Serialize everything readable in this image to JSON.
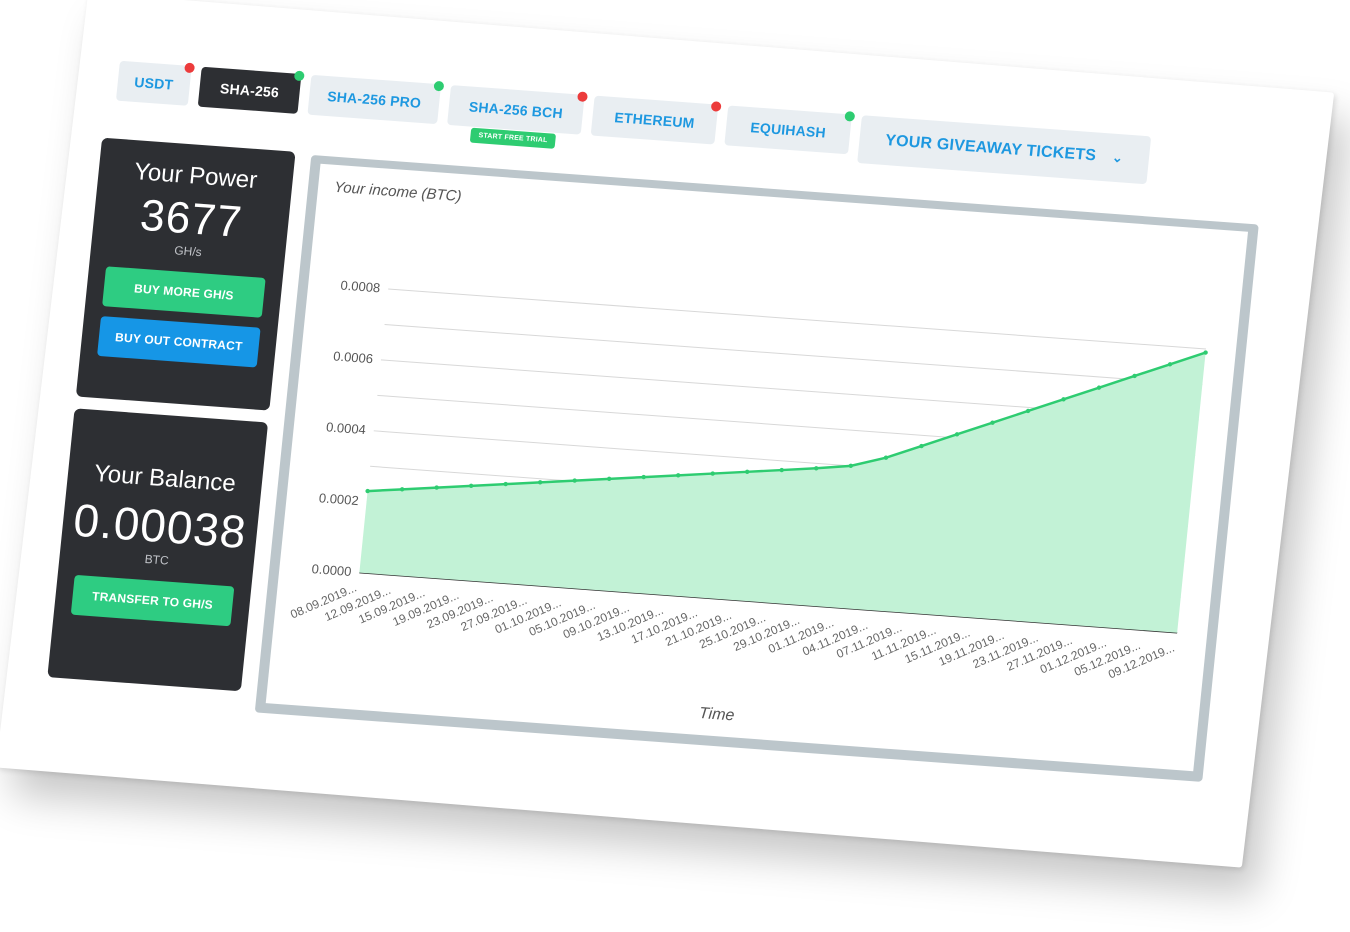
{
  "tabs": [
    {
      "label": "USDT",
      "dot": "red",
      "active": false
    },
    {
      "label": "SHA-256",
      "dot": "green",
      "active": true
    },
    {
      "label": "SHA-256 PRO",
      "dot": "green",
      "active": false
    },
    {
      "label": "SHA-256 BCH",
      "dot": "red",
      "active": false,
      "badge": "START FREE TRIAL"
    },
    {
      "label": "ETHEREUM",
      "dot": "red",
      "active": false
    },
    {
      "label": "EQUIHASH",
      "dot": "green",
      "active": false
    },
    {
      "label": "YOUR GIVEAWAY TICKETS",
      "active": false,
      "icon": "chevron-down-icon"
    }
  ],
  "power": {
    "title": "Your Power",
    "value": "3677",
    "unit": "GH/s",
    "buy_more_label": "BUY MORE GH/S",
    "buy_out_label": "BUY OUT CONTRACT"
  },
  "balance": {
    "title": "Your Balance",
    "value": "0.00038",
    "unit": "BTC",
    "transfer_label": "TRANSFER TO GH/S"
  },
  "colors": {
    "accent_green": "#2ecc71",
    "accent_blue": "#1696e6",
    "dark_card": "#2d2f33",
    "tab_text": "#1e98e0"
  },
  "chart_data": {
    "type": "area",
    "title": "Your income (BTC)",
    "xlabel": "Time",
    "ylabel": "",
    "ylim": [
      0,
      0.0008
    ],
    "yticks": [
      "0.0000",
      "0.0002",
      "0.0004",
      "0.0006",
      "0.0008"
    ],
    "xticks": [
      "08.09.2019...",
      "12.09.2019...",
      "15.09.2019...",
      "19.09.2019...",
      "23.09.2019...",
      "27.09.2019...",
      "01.10.2019...",
      "05.10.2019...",
      "09.10.2019...",
      "13.10.2019...",
      "17.10.2019...",
      "21.10.2019...",
      "25.10.2019...",
      "29.10.2019...",
      "01.11.2019...",
      "04.11.2019...",
      "07.11.2019...",
      "11.11.2019...",
      "15.11.2019...",
      "19.11.2019...",
      "23.11.2019...",
      "27.11.2019...",
      "01.12.2019...",
      "05.12.2019...",
      "09.12.2019..."
    ],
    "series": [
      {
        "values": [
          0.00023,
          0.000242,
          0.000254,
          0.000266,
          0.000278,
          0.00029,
          0.000302,
          0.000314,
          0.000326,
          0.000338,
          0.00035,
          0.000362,
          0.000374,
          0.000386,
          0.0004,
          0.00043,
          0.00047,
          0.00051,
          0.00055,
          0.00059,
          0.00063,
          0.00067,
          0.00071,
          0.00075,
          0.00079
        ]
      }
    ],
    "grid": true
  }
}
